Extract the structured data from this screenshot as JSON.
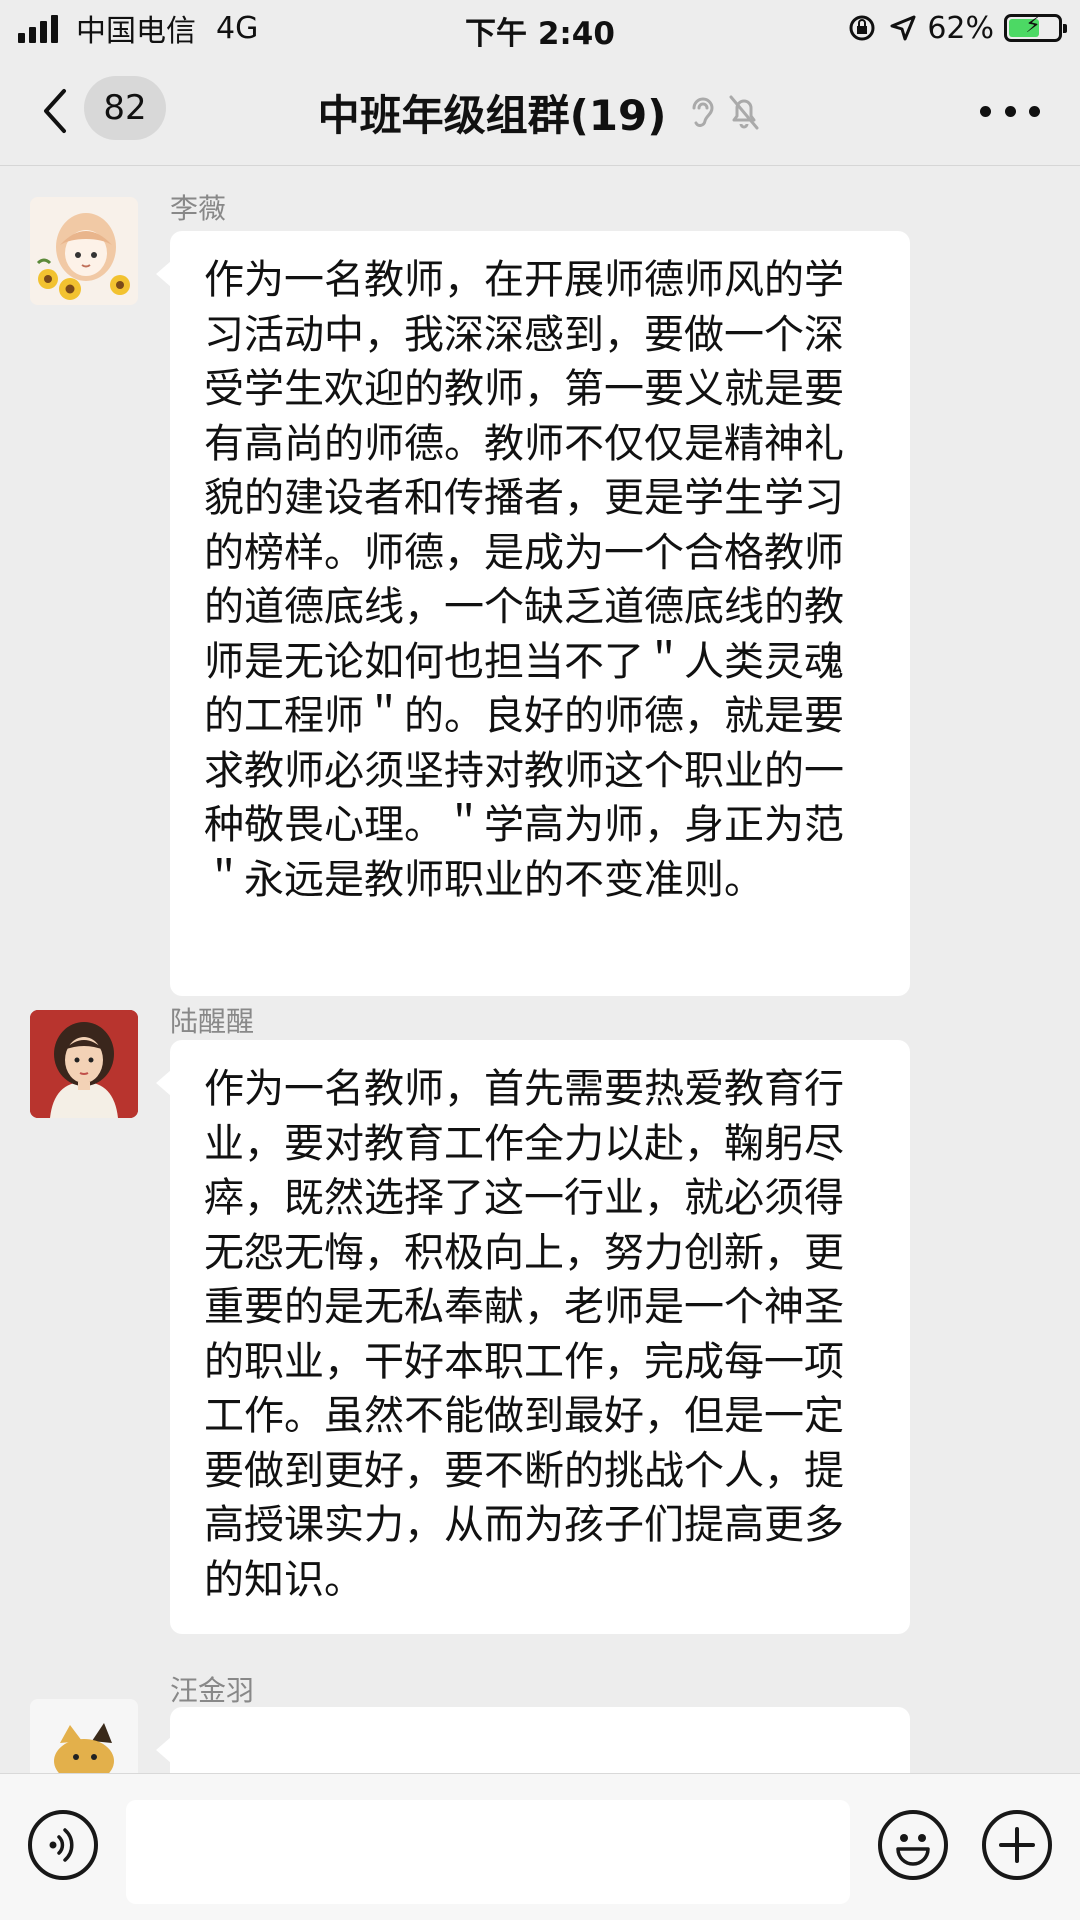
{
  "status_bar": {
    "carrier": "中国电信",
    "network": "4G",
    "time": "下午 2:40",
    "battery_percent": "62%",
    "battery_level": 0.62
  },
  "nav": {
    "unread_count": "82",
    "title": "中班年级组群(19)",
    "icons": [
      "back-chevron-icon",
      "ear-icon",
      "mute-bell-icon",
      "more-dots-icon"
    ]
  },
  "messages": [
    {
      "sender": "李薇",
      "avatar": "girl-sunflower-avatar",
      "text": "作为一名教师，在开展师德师风的学习活动中，我深深感到，要做一个深受学生欢迎的教师，第一要义就是要有高尚的师德。教师不仅仅是精神礼貌的建设者和传播者，更是学生学习的榜样。师德，是成为一个合格教师的道德底线，一个缺乏道德底线的教师是无论如何也担当不了＂人类灵魂的工程师＂的。良好的师德，就是要求教师必须坚持对教师这个职业的一种敬畏心理。＂学高为师，身正为范＂永远是教师职业的不变准则。"
    },
    {
      "sender": "陆醒醒",
      "avatar": "woman-portrait-avatar",
      "text": "作为一名教师，首先需要热爱教育行业，要对教育工作全力以赴，鞠躬尽瘁，既然选择了这一行业，就必须得无怨无悔，积极向上，努力创新，更重要的是无私奉献，老师是一个神圣的职业，干好本职工作，完成每一项工作。虽然不能做到最好，但是一定要做到更好，要不断的挑战个人，提高授课实力，从而为孩子们提高更多的知识。"
    },
    {
      "sender": "汪金羽",
      "avatar": "cartoon-dog-avatar",
      "text": ""
    }
  ],
  "input_bar": {
    "value": "",
    "icons": [
      "voice-icon",
      "emoji-icon",
      "plus-icon"
    ]
  },
  "colors": {
    "background": "#ededed",
    "bubble": "#ffffff",
    "battery_green": "#4cd964"
  }
}
